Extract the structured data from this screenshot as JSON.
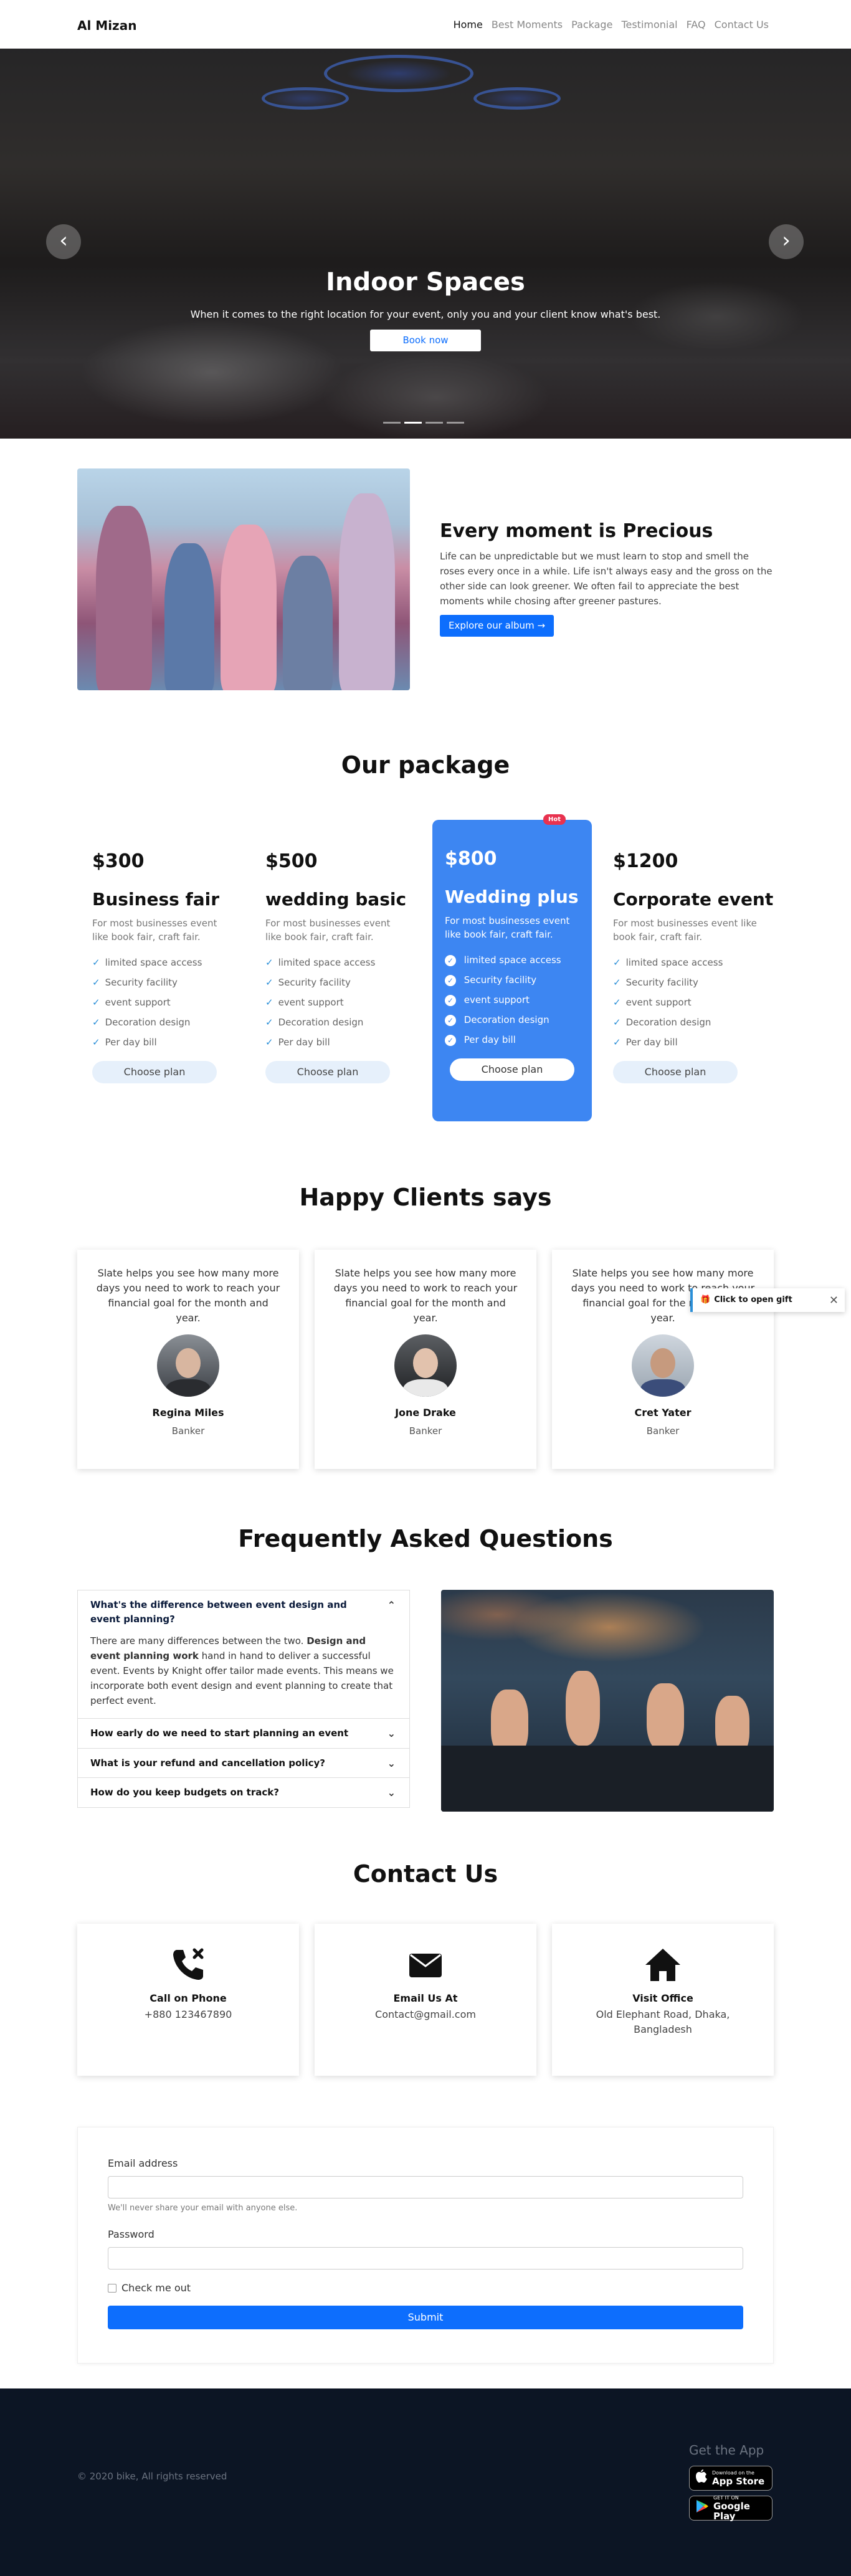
{
  "nav": {
    "brand": "Al Mizan",
    "links": [
      "Home",
      "Best Moments",
      "Package",
      "Testimonial",
      "FAQ",
      "Contact Us"
    ]
  },
  "hero": {
    "title": "Indoor Spaces",
    "subtitle": "When it comes to the right location for your event, only you and your client know what's best.",
    "button": "Book now",
    "prev_icon": "chevron-left-icon",
    "next_icon": "chevron-right-icon",
    "active_slide": 2,
    "slide_count": 4
  },
  "moment": {
    "title": "Every moment is Precious",
    "text": "Life can be unpredictable but we must learn to stop and smell the roses every once in a while. Life isn't always easy and the gross on the other side can look greener. We often fail to appreciate the best moments while chosing after greener pastures.",
    "button": "Explore our album →"
  },
  "packages": {
    "title": "Our package",
    "choose_label": "Choose plan",
    "hot_label": "Hot",
    "items": [
      {
        "price": "$300",
        "name": "Business fair",
        "desc": "For most businesses event like book fair, craft fair."
      },
      {
        "price": "$500",
        "name": "wedding basic",
        "desc": "For most businesses event like book fair, craft fair."
      },
      {
        "price": "$800",
        "name": "Wedding plus",
        "desc": "For most businesses event like book fair, craft fair."
      },
      {
        "price": "$1200",
        "name": "Corporate event",
        "desc": "For most businesses event like book fair, craft fair."
      }
    ],
    "features": [
      "limited space access",
      "Security facility",
      "event support",
      "Decoration design",
      "Per day bill"
    ],
    "highlight_color": "#3d86f2"
  },
  "testimonials": {
    "title": "Happy Clients says",
    "quote": "Slate helps you see how many more days you need to work to reach your financial goal for the month and year.",
    "items": [
      {
        "name": "Regina Miles",
        "role": "Banker"
      },
      {
        "name": "Jone Drake",
        "role": "Banker"
      },
      {
        "name": "Cret Yater",
        "role": "Banker"
      }
    ]
  },
  "gift": {
    "label": "Click to open gift",
    "close": "✕"
  },
  "faq": {
    "title": "Frequently Asked Questions",
    "q1": "What's the difference between event design and event planning?",
    "a1_start": "There are many differences between the two. ",
    "a1_bold": "Design and event planning work",
    "a1_end": " hand in hand to deliver a successful event. Events by Knight offer tailor made events. This means we incorporate both event design and event planning to create that perfect event.",
    "q2": "How early do we need to start planning an event",
    "q3": "What is your refund and cancellation policy?",
    "q4": "How do you keep budgets on track?"
  },
  "contact": {
    "title": "Contact Us",
    "items": [
      {
        "title": "Call on Phone",
        "value": "+880 123467890"
      },
      {
        "title": "Email Us At",
        "value": "Contact@gmail.com"
      },
      {
        "title": "Visit Office",
        "value": "Old Elephant Road, Dhaka, Bangladesh"
      }
    ]
  },
  "form": {
    "email_label": "Email address",
    "email_help": "We'll never share your email with anyone else.",
    "password_label": "Password",
    "check_label": "Check me out",
    "submit": "Submit"
  },
  "footer": {
    "copy": "© 2020 bike, All rights reserved",
    "app_title": "Get the App",
    "appstore_small": "Download on the",
    "appstore_big": "App Store",
    "play_small": "GET IT ON",
    "play_big": "Google Play"
  },
  "colors": {
    "primary": "#0d6efd",
    "footer_bg": "#0c1524",
    "hot": "#e8324f"
  }
}
